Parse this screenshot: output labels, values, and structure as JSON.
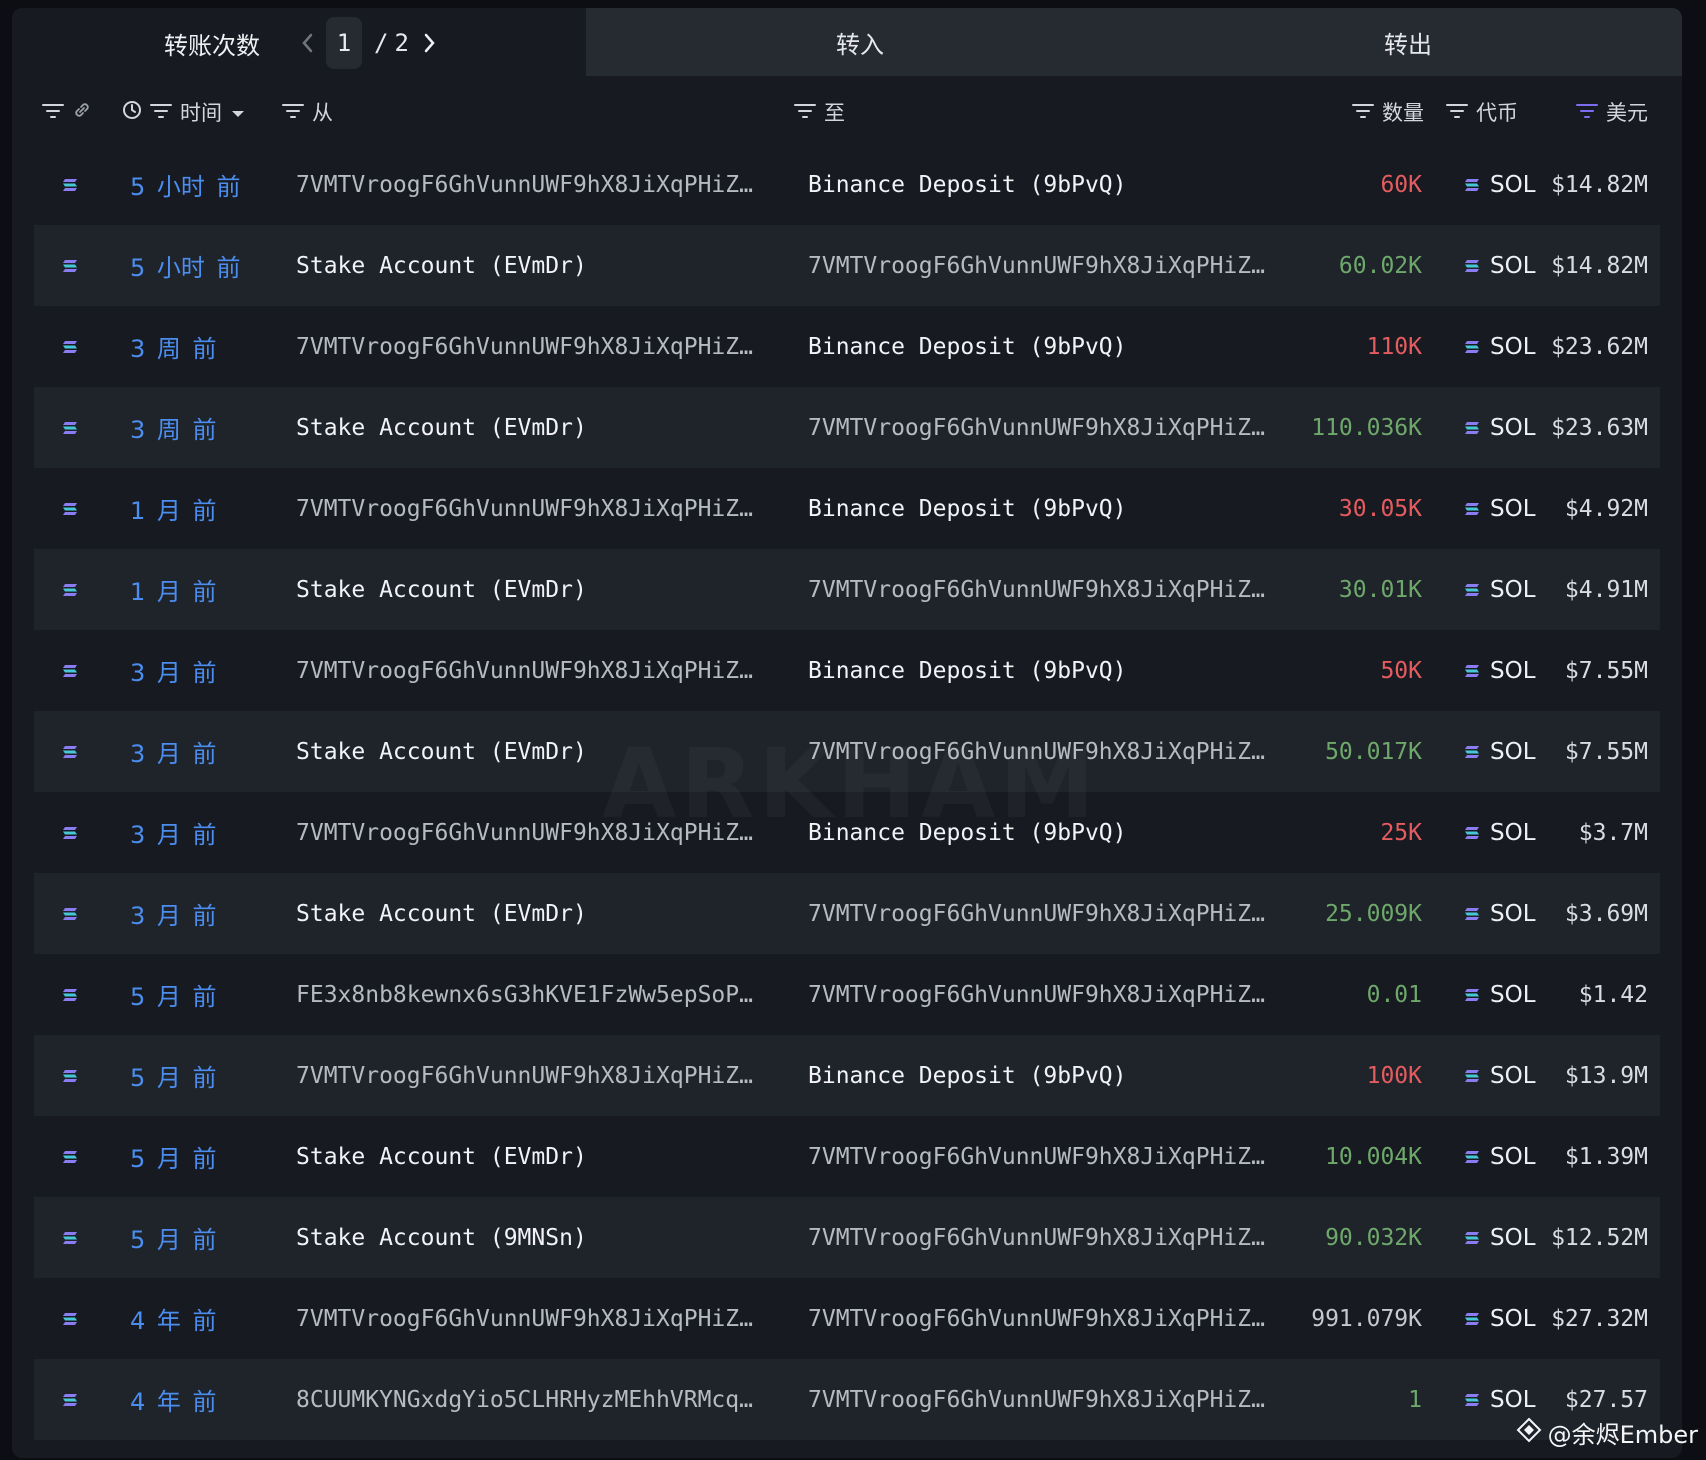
{
  "tabs": {
    "title": "转账次数",
    "page_current": "1",
    "page_separator": "/",
    "page_total": "2",
    "in_label": "转入",
    "out_label": "转出"
  },
  "header": {
    "time": "时间",
    "from": "从",
    "to": "至",
    "amount": "数量",
    "token": "代币",
    "usd": "美元"
  },
  "rows": [
    {
      "time": "5 小时 前",
      "from": "7VMTVroogF6GhVunnUWF9hX8JiXqPHiZ…",
      "to": "Binance Deposit (9bPvQ)",
      "amount": "60K",
      "direction": "out",
      "token": "SOL",
      "usd": "$14.82M"
    },
    {
      "time": "5 小时 前",
      "from": "Stake Account (EVmDr)",
      "to": "7VMTVroogF6GhVunnUWF9hX8JiXqPHiZ…",
      "amount": "60.02K",
      "direction": "in",
      "token": "SOL",
      "usd": "$14.82M"
    },
    {
      "time": "3 周 前",
      "from": "7VMTVroogF6GhVunnUWF9hX8JiXqPHiZ…",
      "to": "Binance Deposit (9bPvQ)",
      "amount": "110K",
      "direction": "out",
      "token": "SOL",
      "usd": "$23.62M"
    },
    {
      "time": "3 周 前",
      "from": "Stake Account (EVmDr)",
      "to": "7VMTVroogF6GhVunnUWF9hX8JiXqPHiZ…",
      "amount": "110.036K",
      "direction": "in",
      "token": "SOL",
      "usd": "$23.63M"
    },
    {
      "time": "1 月 前",
      "from": "7VMTVroogF6GhVunnUWF9hX8JiXqPHiZ…",
      "to": "Binance Deposit (9bPvQ)",
      "amount": "30.05K",
      "direction": "out",
      "token": "SOL",
      "usd": "$4.92M"
    },
    {
      "time": "1 月 前",
      "from": "Stake Account (EVmDr)",
      "to": "7VMTVroogF6GhVunnUWF9hX8JiXqPHiZ…",
      "amount": "30.01K",
      "direction": "in",
      "token": "SOL",
      "usd": "$4.91M"
    },
    {
      "time": "3 月 前",
      "from": "7VMTVroogF6GhVunnUWF9hX8JiXqPHiZ…",
      "to": "Binance Deposit (9bPvQ)",
      "amount": "50K",
      "direction": "out",
      "token": "SOL",
      "usd": "$7.55M"
    },
    {
      "time": "3 月 前",
      "from": "Stake Account (EVmDr)",
      "to": "7VMTVroogF6GhVunnUWF9hX8JiXqPHiZ…",
      "amount": "50.017K",
      "direction": "in",
      "token": "SOL",
      "usd": "$7.55M"
    },
    {
      "time": "3 月 前",
      "from": "7VMTVroogF6GhVunnUWF9hX8JiXqPHiZ…",
      "to": "Binance Deposit (9bPvQ)",
      "amount": "25K",
      "direction": "out",
      "token": "SOL",
      "usd": "$3.7M"
    },
    {
      "time": "3 月 前",
      "from": "Stake Account (EVmDr)",
      "to": "7VMTVroogF6GhVunnUWF9hX8JiXqPHiZ…",
      "amount": "25.009K",
      "direction": "in",
      "token": "SOL",
      "usd": "$3.69M"
    },
    {
      "time": "5 月 前",
      "from": "FE3x8nb8kewnx6sG3hKVE1FzWw5epSoP…",
      "to": "7VMTVroogF6GhVunnUWF9hX8JiXqPHiZ…",
      "amount": "0.01",
      "direction": "in",
      "token": "SOL",
      "usd": "$1.42"
    },
    {
      "time": "5 月 前",
      "from": "7VMTVroogF6GhVunnUWF9hX8JiXqPHiZ…",
      "to": "Binance Deposit (9bPvQ)",
      "amount": "100K",
      "direction": "out",
      "token": "SOL",
      "usd": "$13.9M"
    },
    {
      "time": "5 月 前",
      "from": "Stake Account (EVmDr)",
      "to": "7VMTVroogF6GhVunnUWF9hX8JiXqPHiZ…",
      "amount": "10.004K",
      "direction": "in",
      "token": "SOL",
      "usd": "$1.39M"
    },
    {
      "time": "5 月 前",
      "from": "Stake Account (9MNSn)",
      "to": "7VMTVroogF6GhVunnUWF9hX8JiXqPHiZ…",
      "amount": "90.032K",
      "direction": "in",
      "token": "SOL",
      "usd": "$12.52M"
    },
    {
      "time": "4 年 前",
      "from": "7VMTVroogF6GhVunnUWF9hX8JiXqPHiZ…",
      "to": "7VMTVroogF6GhVunnUWF9hX8JiXqPHiZ…",
      "amount": "991.079K",
      "direction": "self",
      "token": "SOL",
      "usd": "$27.32M"
    },
    {
      "time": "4 年 前",
      "from": "8CUUMKYNGxdgYio5CLHRHyzMEhhVRMcq…",
      "to": "7VMTVroogF6GhVunnUWF9hX8JiXqPHiZ…",
      "amount": "1",
      "direction": "in",
      "token": "SOL",
      "usd": "$27.57"
    }
  ],
  "watermark": "ARKHAM",
  "credit": "@余烬Ember",
  "colors": {
    "out": "#e45c5f",
    "in": "#6ea86b",
    "time_link": "#4b8ef0",
    "usd_filter_active": "#7c6cf0"
  }
}
